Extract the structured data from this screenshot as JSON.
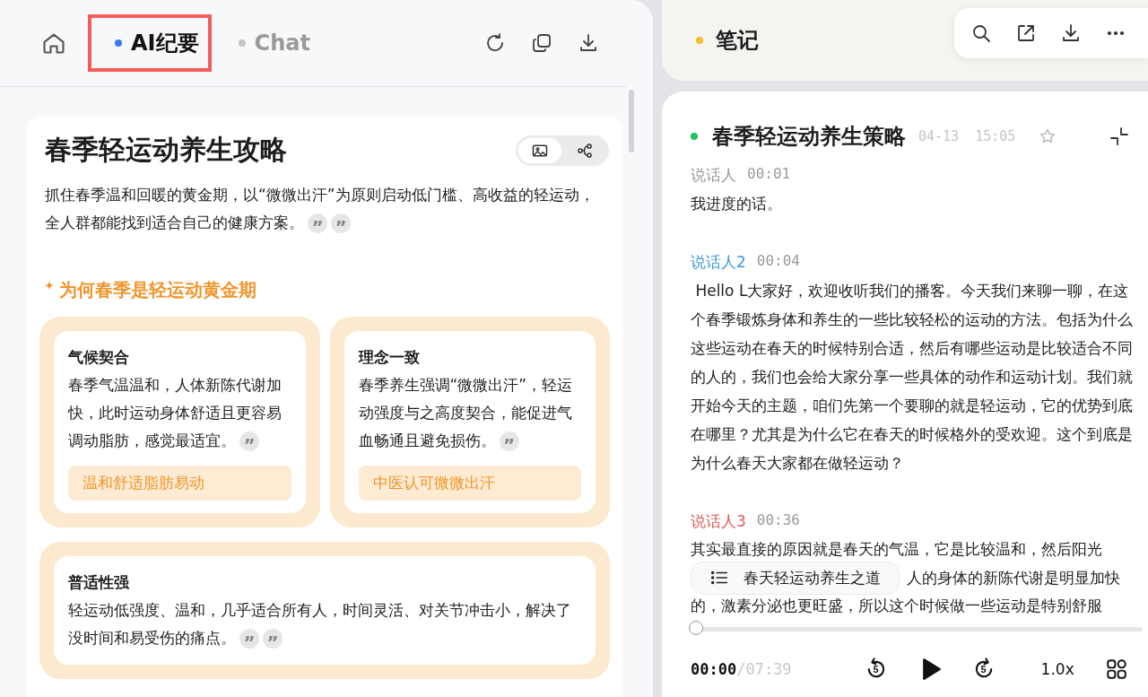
{
  "left": {
    "tabs": [
      {
        "label": "AI纪要",
        "selected": true
      },
      {
        "label": "Chat",
        "selected": false
      }
    ],
    "summary": {
      "title": "春季轻运动养生攻略",
      "view_toggle": [
        {
          "kind": "image",
          "selected": true
        },
        {
          "kind": "mindmap",
          "selected": false
        }
      ],
      "intro": "抓住春季温和回暖的黄金期，以“微微出汗”为原则启动低门槛、高收益的轻运动，全人群都能找到适合自己的健康方案。",
      "intro_citations": [
        "”",
        "”"
      ],
      "section_heading": "为何春季是轻运动黄金期",
      "cards": [
        {
          "title": "气候契合",
          "text": "春季气温温和，人体新陈代谢加快，此时运动身体舒适且更容易调动脂肪，感觉最适宜。",
          "citations": [
            "”"
          ],
          "tag": "温和舒适脂肪易动"
        },
        {
          "title": "理念一致",
          "text": "春季养生强调“微微出汗”，轻运动强度与之高度契合，能促进气血畅通且避免损伤。",
          "citations": [
            "”"
          ],
          "tag": "中医认可微微出汗"
        },
        {
          "title": "普适性强",
          "text": "轻运动低强度、温和，几乎适合所有人，时间灵活、对关节冲击小，解决了没时间和易受伤的痛点。",
          "citations": [
            "”",
            "”"
          ]
        }
      ]
    }
  },
  "right": {
    "header": {
      "title": "笔记"
    },
    "note": {
      "title": "春季轻运动养生策略",
      "date": "04-13  15:05",
      "starred": false,
      "segments": [
        {
          "speaker": "说话人",
          "color": "#999999",
          "time": "00:01",
          "text": "我进度的话。"
        },
        {
          "speaker": "说话人2",
          "color": "#3b9ad9",
          "time": "00:04",
          "text": " Hello L大家好，欢迎收听我们的播客。今天我们来聊一聊，在这个春季锻炼身体和养生的一些比较轻松的运动的方法。包括为什么这些运动在春天的时候特别合适，然后有哪些运动是比较适合不同的人的，我们也会给大家分享一些具体的动作和运动计划。我们就开始今天的主题，咱们先第一个要聊的就是轻运动，它的优势到底在哪里？尤其是为什么它在春天的时候格外的受欢迎。这个到底是为什么春天大家都在做轻运动？"
        },
        {
          "speaker": "说话人3",
          "color": "#e05a5a",
          "time": "00:36",
          "lines": [
            "其实最直接的原因就是春天的气温，它是比较温和，然后阳光",
            "人的身体的新陈代谢是明显加快",
            "的，激素分泌也更旺盛，所以这个时候做一些运动是特别舒服"
          ]
        }
      ],
      "chapter": "春天轻运动养生之道"
    },
    "player": {
      "skip_back": "5",
      "skip_forward": "5",
      "elapsed": "00:00",
      "duration": "/07:39",
      "level": 0,
      "playing": false,
      "speed": "1.0x"
    }
  }
}
